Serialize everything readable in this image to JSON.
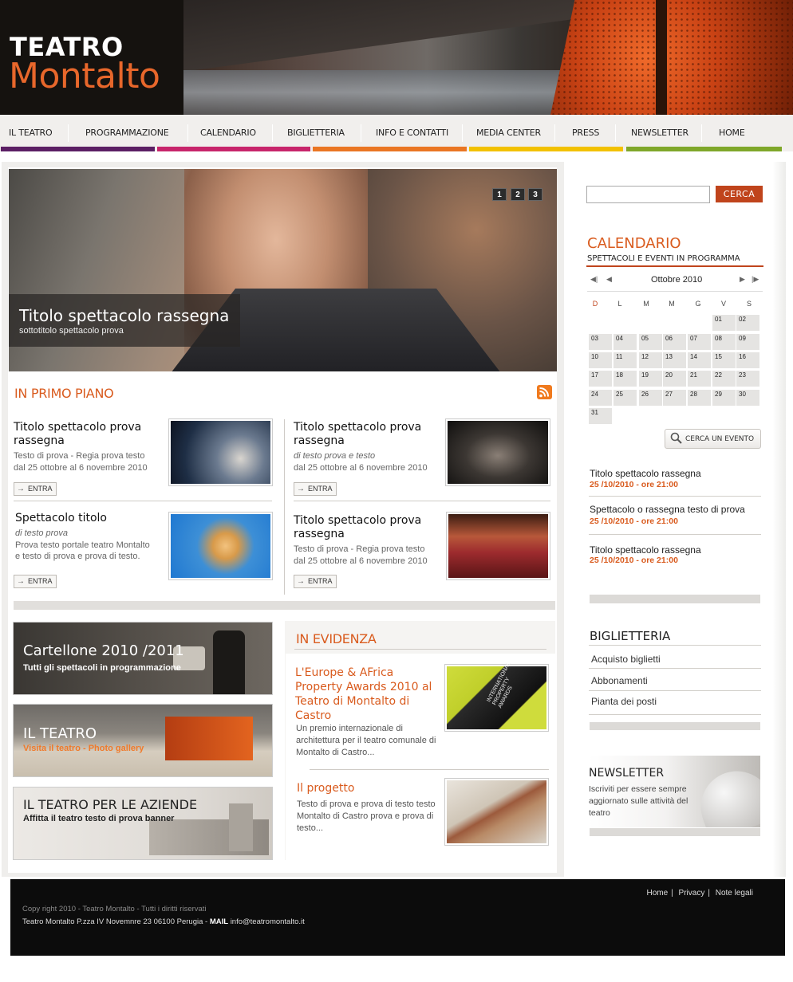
{
  "logo": {
    "line1": "TEATRO",
    "line2": "Montalto"
  },
  "nav": {
    "items": [
      {
        "label": "IL TEATRO"
      },
      {
        "label": "PROGRAMMAZIONE"
      },
      {
        "label": "CALENDARIO"
      },
      {
        "label": "BIGLIETTERIA"
      },
      {
        "label": "INFO E CONTATTI"
      },
      {
        "label": "MEDIA CENTER"
      },
      {
        "label": "PRESS"
      },
      {
        "label": "NEWSLETTER"
      },
      {
        "label": "HOME"
      }
    ],
    "bar_colors": [
      "#5b1f64",
      "#c7256b",
      "#ea7623",
      "#f2c100",
      "#7fa72a"
    ]
  },
  "hero": {
    "title": "Titolo spettacolo rassegna",
    "subtitle": "sottotitolo spettacolo prova",
    "pages": [
      "1",
      "2",
      "3"
    ]
  },
  "primo_piano": {
    "title": "IN PRIMO PIANO",
    "cards": [
      {
        "title": "Titolo spettacolo prova rassegna",
        "line1": "Testo di prova - Regia prova testo",
        "line2": "dal 25 ottobre al 6 novembre 2010",
        "button": "ENTRA"
      },
      {
        "title": "Titolo spettacolo prova rassegna",
        "line1": "di testo prova e testo",
        "line2": "dal 25 ottobre al 6 novembre 2010",
        "button": "ENTRA"
      },
      {
        "title": "Spettacolo titolo",
        "line1": "di testo prova",
        "line2": "Prova testo portale teatro Montalto",
        "line3": "e testo di prova e prova di testo.",
        "button": "ENTRA"
      },
      {
        "title": "Titolo spettacolo prova rassegna",
        "line1": "Testo di prova - Regia prova testo",
        "line2": "dal 25 ottobre al 6 novembre 2010",
        "button": "ENTRA"
      }
    ]
  },
  "banners": [
    {
      "title": "Cartellone 2010 /2011",
      "subtitle": "Tutti gli spettacoli in programmazione"
    },
    {
      "title": "IL TEATRO",
      "subtitle": "Visita il teatro - Photo gallery"
    },
    {
      "title": "IL TEATRO PER LE AZIENDE",
      "subtitle": "Affitta il teatro testo di prova banner"
    }
  ],
  "evidenza": {
    "title": "IN EVIDENZA",
    "items": [
      {
        "title": "L'Europe & AFrica Property Awards 2010 al Teatro di Montalto di Castro",
        "text": "Un premio internazionale di architettura per il teatro comunale di Montalto di Castro...",
        "image_text": "INTERNATIONAL PROPERTY AWARDS"
      },
      {
        "title": "Il progetto",
        "text": "Testo di prova e prova di testo testo Montalto di Castro prova e prova di testo..."
      }
    ]
  },
  "search": {
    "placeholder": "",
    "button": "CERCA"
  },
  "calendar": {
    "title": "CALENDARIO",
    "subtitle": "SPETTACOLI E EVENTI IN PROGRAMMA",
    "month": "Ottobre 2010",
    "day_headers": [
      "D",
      "L",
      "M",
      "M",
      "G",
      "V",
      "S"
    ],
    "days": [
      "01",
      "02",
      "03",
      "04",
      "05",
      "06",
      "07",
      "08",
      "09",
      "10",
      "11",
      "12",
      "13",
      "14",
      "15",
      "16",
      "17",
      "18",
      "19",
      "20",
      "21",
      "22",
      "23",
      "24",
      "25",
      "26",
      "27",
      "28",
      "29",
      "30",
      "31"
    ],
    "search_event": "CERCA UN EVENTO"
  },
  "events": [
    {
      "title": "Titolo spettacolo rassegna",
      "date": "25 /10/2010 - ore 21:00"
    },
    {
      "title": "Spettacolo o rassegna testo di prova",
      "date": "25 /10/2010 - ore 21:00"
    },
    {
      "title": "Titolo spettacolo rassegna",
      "date": "25 /10/2010 - ore 21:00"
    }
  ],
  "biglietteria": {
    "title": "BIGLIETTERIA",
    "items": [
      "Acquisto biglietti",
      "Abbonamenti",
      "Pianta dei posti"
    ]
  },
  "newsletter": {
    "title": "NEWSLETTER",
    "text": "Iscriviti per essere sempre aggiornato sulle attività del teatro"
  },
  "footer": {
    "links": [
      "Home",
      "Privacy",
      "Note legali"
    ],
    "copyright": "Copy right 2010 - Teatro Montalto - Tutti i diritti riservati",
    "address": "Teatro Montalto  P.zza IV Novemnre 23 06100 Perugia - ",
    "mail_label": "MAIL",
    "mail": "info@teatromontalto.it"
  }
}
